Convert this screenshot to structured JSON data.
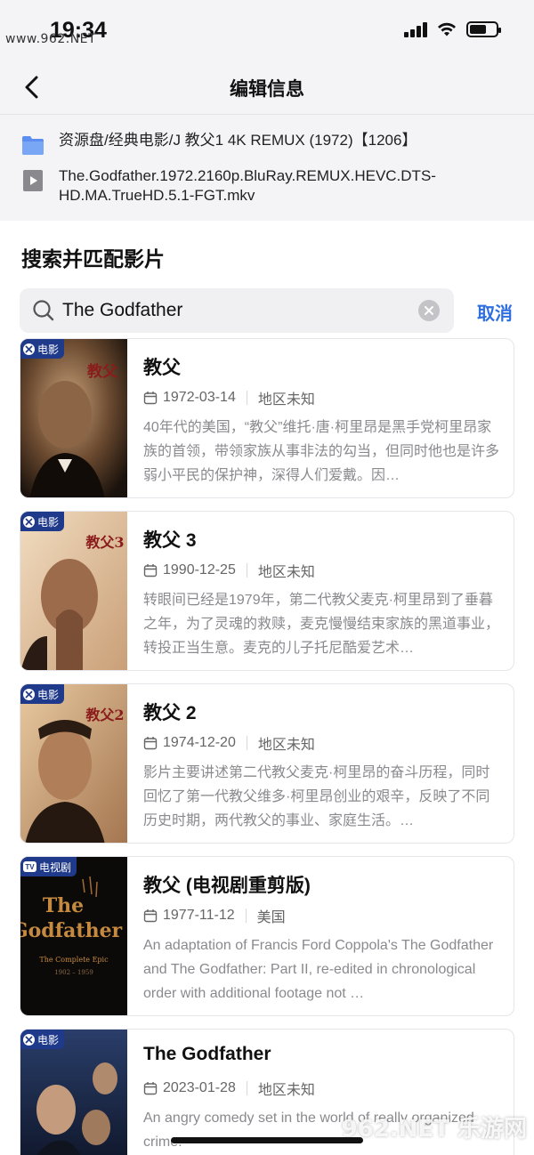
{
  "status_bar": {
    "time": "19:34",
    "watermark": "www.962.NET"
  },
  "nav": {
    "title": "编辑信息"
  },
  "file": {
    "folder_path": "资源盘/经典电影/J 教父1 4K REMUX (1972)【1206】",
    "file_name": "The.Godfather.1972.2160p.BluRay.REMUX.HEVC.DTS-HD.MA.TrueHD.5.1-FGT.mkv"
  },
  "section": {
    "title": "搜索并匹配影片"
  },
  "search": {
    "value": "The Godfather",
    "cancel_label": "取消"
  },
  "results": [
    {
      "badge": "电影",
      "title": "教父",
      "date": "1972-03-14",
      "region": "地区未知",
      "description": "40年代的美国，“教父”维托·唐·柯里昂是黑手党柯里昂家族的首领，带领家族从事非法的勾当，但同时他也是许多弱小平民的保护神，深得人们爱戴。因…"
    },
    {
      "badge": "电影",
      "title": "教父 3",
      "date": "1990-12-25",
      "region": "地区未知",
      "description": "转眼间已经是1979年，第二代教父麦克·柯里昂到了垂暮之年，为了灵魂的救赎，麦克慢慢结束家族的黑道事业，转投正当生意。麦克的儿子托尼酷爱艺术…"
    },
    {
      "badge": "电影",
      "title": "教父 2",
      "date": "1974-12-20",
      "region": "地区未知",
      "description": "影片主要讲述第二代教父麦克·柯里昂的奋斗历程，同时回忆了第一代教父维多·柯里昂创业的艰辛，反映了不同历史时期，两代教父的事业、家庭生活。…"
    },
    {
      "badge": "电视剧",
      "title": "教父 (电视剧重剪版)",
      "date": "1977-11-12",
      "region": "美国",
      "description": "An adaptation of Francis Ford Coppola's The Godfather and The Godfather: Part II, re-edited in chronological order with additional footage not …"
    },
    {
      "badge": "电影",
      "title": "The Godfather",
      "date": "2023-01-28",
      "region": "地区未知",
      "description": "An angry comedy set in the world of really organized crime."
    }
  ],
  "posters": {
    "p1_text": "教父",
    "p2_text": "教父3",
    "p3_text": "教父2",
    "p4_line1": "The",
    "p4_line2": "Godfather",
    "p4_sub": "The Complete Epic",
    "p4_years": "1902 – 1959"
  },
  "bottom_watermark": "962.NET 乐游网",
  "colors": {
    "accent": "#2f6fe0",
    "badge": "#1f3a8a",
    "folder": "#5b8ef0"
  }
}
